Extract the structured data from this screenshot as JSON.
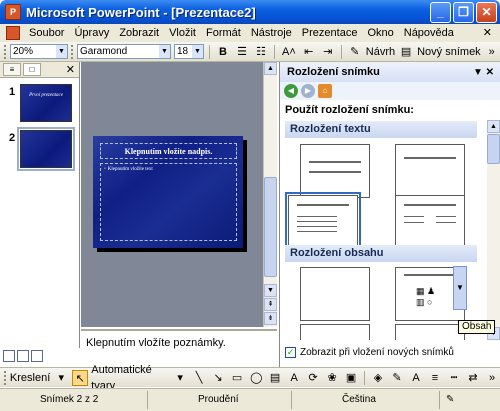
{
  "window": {
    "title": "Microsoft PowerPoint - [Prezentace2]"
  },
  "menu": {
    "items": [
      "Soubor",
      "Úpravy",
      "Zobrazit",
      "Vložit",
      "Formát",
      "Nástroje",
      "Prezentace",
      "Okno",
      "Nápověda"
    ]
  },
  "toolbar": {
    "zoom": "20%",
    "font": "Garamond",
    "size": "18",
    "bold": "B",
    "design_label": "Návrh",
    "new_slide_label": "Nový snímek"
  },
  "slides": {
    "thumb1_num": "1",
    "thumb2_num": "2",
    "thumb1_text": "Prvoí prezentace",
    "slide_title_placeholder": "Klepnutím vložíte nadpis.",
    "slide_body_placeholder": "Klepnutím vložíte text"
  },
  "notes": {
    "placeholder": "Klepnutím vložíte poznámky."
  },
  "taskpane": {
    "title": "Rozložení snímku",
    "apply_label": "Použít rozložení snímku:",
    "section_text": "Rozložení textu",
    "section_content": "Rozložení obsahu",
    "show_on_insert": "Zobrazit při vložení nových snímků",
    "tooltip": "Obsah"
  },
  "drawbar": {
    "draw_label": "Kreslení",
    "autoshapes_label": "Automatické tvary"
  },
  "status": {
    "slide": "Snímek 2 z 2",
    "design": "Proudění",
    "language": "Čeština"
  },
  "colors": {
    "title_bar": "#0b5fe0",
    "slide_bg": "#0f1f86",
    "chrome": "#ece9d8"
  }
}
